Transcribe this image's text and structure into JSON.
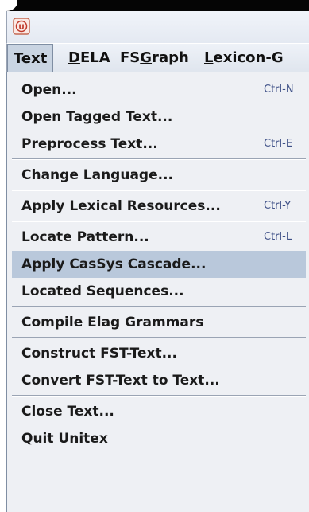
{
  "app": {
    "icon": "unitex-app-icon",
    "icon_text": "U"
  },
  "menubar": {
    "menus": [
      {
        "label": "Text",
        "mnemonic_index": 0
      },
      {
        "label": "DELA",
        "mnemonic_index": 0
      },
      {
        "label": "FSGraph",
        "mnemonic_index": 2
      },
      {
        "label": "Lexicon-G",
        "mnemonic_index": 0
      }
    ]
  },
  "text_menu": {
    "items": [
      {
        "label": "Open...",
        "accelerator": "Ctrl-N"
      },
      {
        "label": "Open Tagged Text...",
        "accelerator": ""
      },
      {
        "label": "Preprocess Text...",
        "accelerator": "Ctrl-E"
      },
      {
        "label": "Change Language...",
        "accelerator": ""
      },
      {
        "label": "Apply Lexical Resources...",
        "accelerator": "Ctrl-Y"
      },
      {
        "label": "Locate Pattern...",
        "accelerator": "Ctrl-L"
      },
      {
        "label": "Apply CasSys Cascade...",
        "accelerator": ""
      },
      {
        "label": "Located Sequences...",
        "accelerator": ""
      },
      {
        "label": "Compile Elag Grammars",
        "accelerator": ""
      },
      {
        "label": "Construct FST-Text...",
        "accelerator": ""
      },
      {
        "label": "Convert FST-Text to Text...",
        "accelerator": ""
      },
      {
        "label": "Close Text...",
        "accelerator": ""
      },
      {
        "label": "Quit Unitex",
        "accelerator": ""
      }
    ],
    "selected": "Apply CasSys Cascade..."
  },
  "colors": {
    "selection": "#b9c8db",
    "accelerator": "#3d4f86",
    "menu_background": "#eef0f4"
  }
}
